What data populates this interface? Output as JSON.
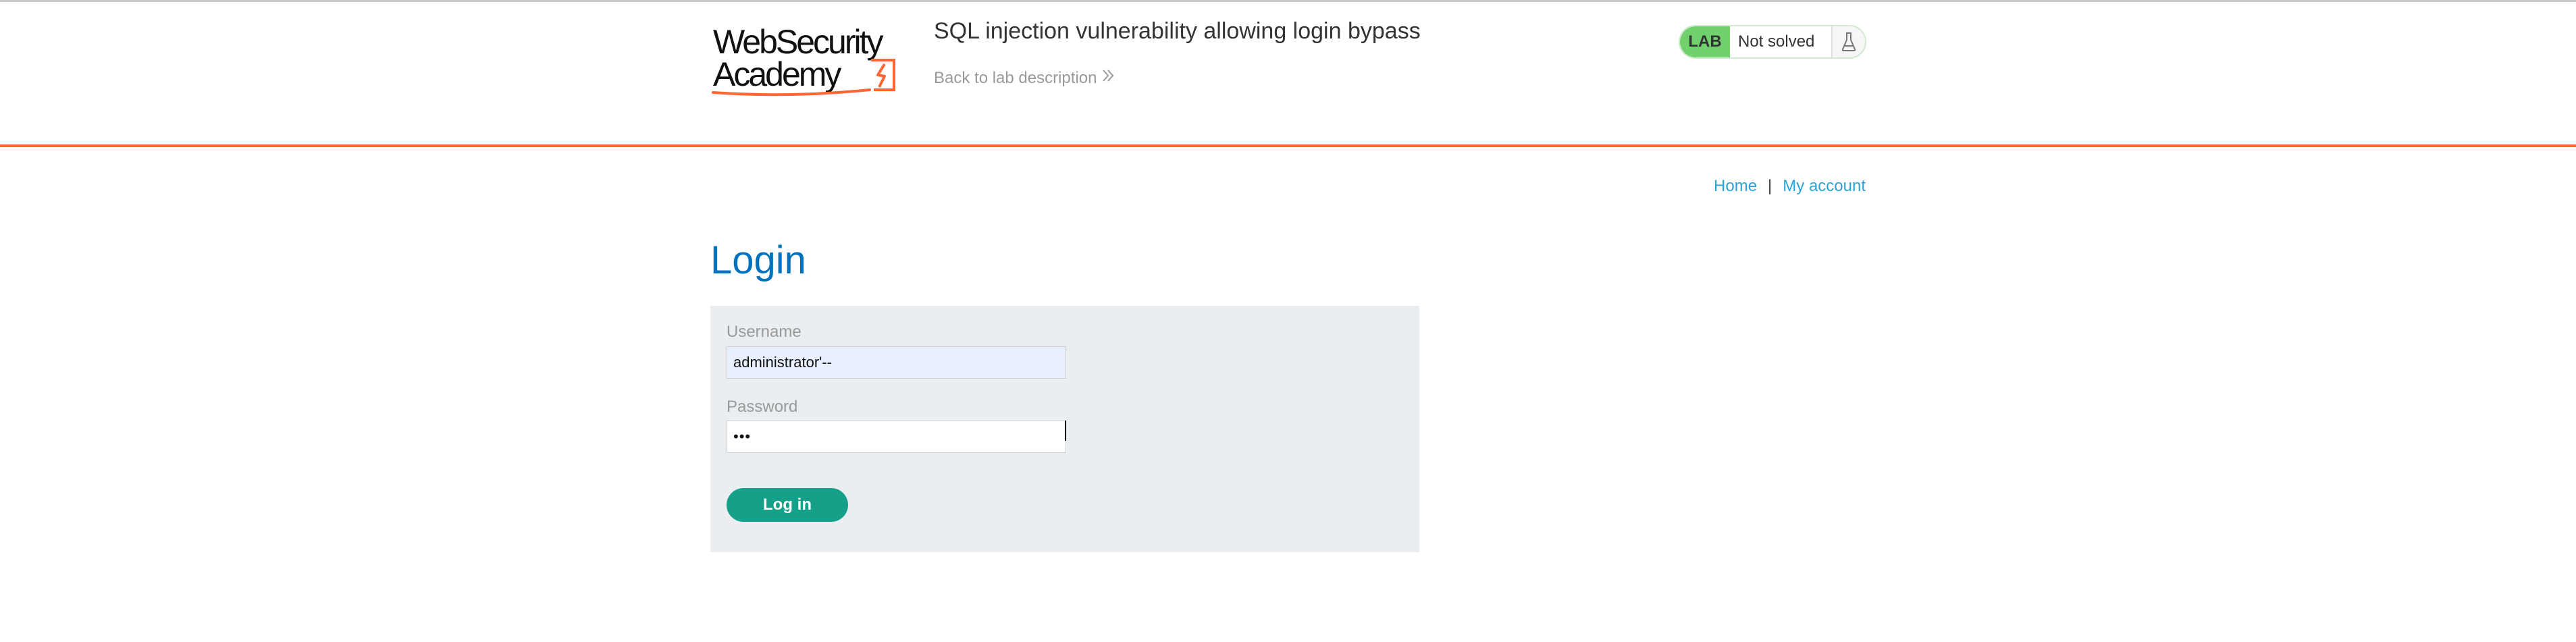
{
  "header": {
    "logo": {
      "line1": "WebSecurity",
      "line2": "Academy"
    },
    "lab_title": "SQL injection vulnerability allowing login bypass",
    "back_link": "Back to lab description",
    "lab_status": {
      "badge": "LAB",
      "state": "Not solved"
    }
  },
  "nav": {
    "home": "Home",
    "separator": "|",
    "my_account": "My account"
  },
  "login": {
    "heading": "Login",
    "username_label": "Username",
    "username_value": "administrator'--",
    "password_label": "Password",
    "password_value": "•••",
    "submit_label": "Log in"
  },
  "icons": {
    "back": "double-chevron-right-icon",
    "flask": "flask-icon",
    "logo_mark": "lightning-bolt-icon"
  },
  "colors": {
    "accent_orange": "#ff6633",
    "heading_blue": "#0071bc",
    "link_blue": "#29a3d5",
    "lab_green": "#70d16d",
    "button_green": "#15a08a",
    "panel_grey": "#ebeef0"
  }
}
